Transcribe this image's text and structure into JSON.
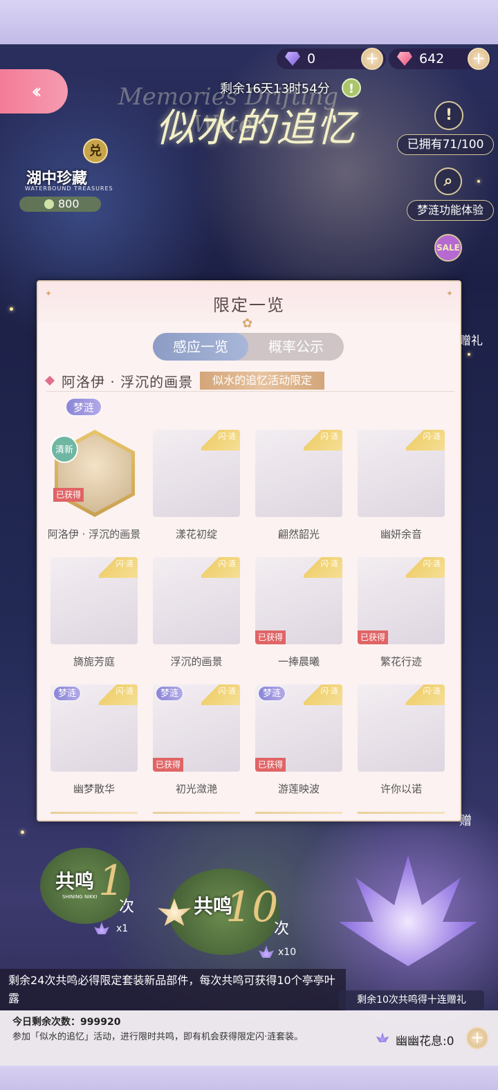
{
  "currency": {
    "diamond_purple": "0",
    "diamond_pink": "642"
  },
  "timer": "剩余16天13时54分",
  "event": {
    "title": "似水的追忆",
    "subtitle": "Memories Drifting Water"
  },
  "side": {
    "owned": "已拥有71/100",
    "feature_trial": "梦涟功能体验",
    "gift_label": "赠礼",
    "gift_label_2": "赠"
  },
  "treasure": {
    "badge": "兑",
    "title": "湖中珍藏",
    "subtitle": "WATERBOUND TREASURES",
    "count": "800"
  },
  "modal": {
    "title": "限定一览",
    "tabs": [
      "感应一览",
      "概率公示"
    ],
    "suit_name": "阿洛伊 · 浮沉的画景",
    "suit_tag": "似水的追忆活动限定",
    "type_badge": "梦涟",
    "corner_label": "闪·涟",
    "fresh_label": "清新",
    "owned_label": "已获得",
    "items": [
      {
        "name": "阿洛伊 · 浮沉的画景"
      },
      {
        "name": "漾花初绽"
      },
      {
        "name": "翩然韶光"
      },
      {
        "name": "幽妍余音"
      },
      {
        "name": "旖旎芳庭"
      },
      {
        "name": "浮沉的画景"
      },
      {
        "name": "一捧晨曦"
      },
      {
        "name": "繁花行迹"
      },
      {
        "name": "幽梦散华"
      },
      {
        "name": "初光潋滟"
      },
      {
        "name": "游莲映波"
      },
      {
        "name": "许你以诺"
      }
    ]
  },
  "draw": {
    "single_label": "共鸣",
    "single_num": "1",
    "single_unit": "次",
    "single_cost": "x1",
    "ten_label": "共鸣",
    "ten_num": "10",
    "ten_unit": "次",
    "ten_cost": "x10",
    "brand": "SHINING NIKKI"
  },
  "info": {
    "guarantee": "剩余24次共鸣必得限定套装新品部件，每次共鸣可获得10个亭亭叶露",
    "bonus": "剩余10次共鸣得十连赠礼",
    "remain_today": "今日剩余次数：999920",
    "description": "参加「似水的追忆」活动，进行限时共鸣，即有机会获得限定闪·涟套装。",
    "bloom": "幽幽花息:0"
  },
  "colors": {
    "accent_pink": "#f47c98",
    "gold": "#d9b786",
    "owned_red": "#e06466",
    "badge_purple": "#8a86d6"
  }
}
